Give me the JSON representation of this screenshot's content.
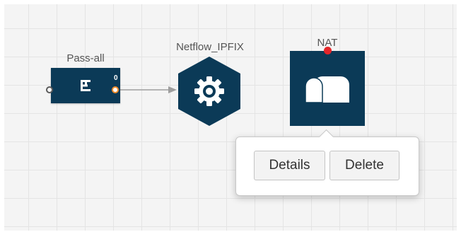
{
  "nodes": {
    "pass_all": {
      "label": "Pass-all",
      "port_number": "0",
      "icon": "filter-icon"
    },
    "netflow": {
      "label": "Netflow_IPFIX",
      "icon": "gear-icon"
    },
    "nat": {
      "label": "NAT",
      "icon": "mailbox-icon",
      "status": "error"
    }
  },
  "popover": {
    "details_label": "Details",
    "delete_label": "Delete"
  },
  "colors": {
    "node_fill": "#0b3a57",
    "out_port": "#f08c2a",
    "status_dot": "#e4262a",
    "connector": "#9e9e9e"
  }
}
